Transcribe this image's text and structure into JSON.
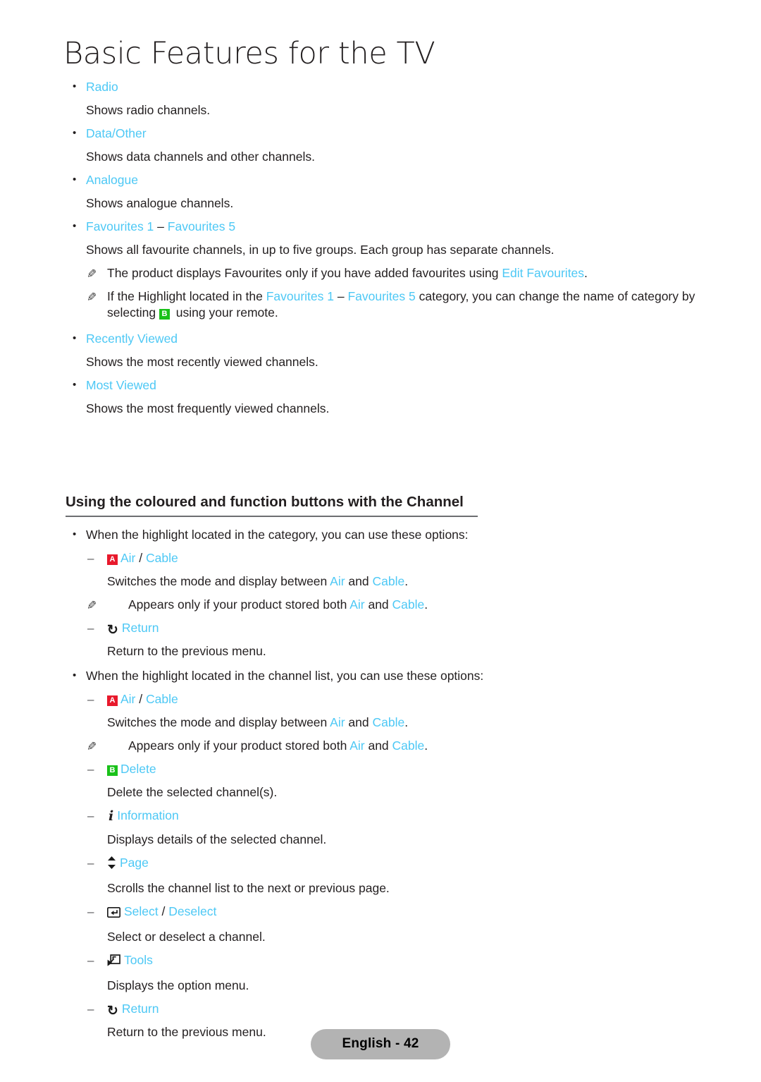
{
  "page_title": "Basic Features for the TV",
  "colors": {
    "link_cyan": "#4dc8f5",
    "text_black": "#231f20",
    "badge_a_red": "#e8192c",
    "badge_b_green": "#19c119",
    "heading_rule": "#6d6e71",
    "footer_pill_bg": "#b3b3b3"
  },
  "items": {
    "radio": {
      "term": "Radio",
      "desc": "Shows radio channels."
    },
    "data_other": {
      "term": "Data/Other",
      "desc": "Shows data channels and other channels."
    },
    "analogue": {
      "term": "Analogue",
      "desc": "Shows analogue channels."
    },
    "favourites": {
      "term_a": "Favourites 1",
      "term_dash": " – ",
      "term_b": "Favourites 5",
      "desc": "Shows all favourite channels, in up to five groups. Each group has separate channels.",
      "note1_pre": "The product displays Favourites only if you have added favourites using ",
      "note1_link": "Edit Favourites",
      "note1_post": ".",
      "note2_pre": "If the Highlight located in the ",
      "note2_link_a": "Favourites 1",
      "note2_dash": " – ",
      "note2_link_b": "Favourites 5",
      "note2_mid": " category, you can change the name of category by selecting ",
      "note2_badge": "B",
      "note2_post": " using your remote."
    },
    "recently_viewed": {
      "term": "Recently Viewed",
      "desc": "Shows the most recently viewed channels."
    },
    "most_viewed": {
      "term": "Most Viewed",
      "desc": "Shows the most frequently viewed channels."
    }
  },
  "section": {
    "heading": "Using the coloured and function buttons with the Channel",
    "category_intro": "When the highlight located in the category, you can use these options:",
    "channellist_intro": "When the highlight located in the channel list, you can use these options:",
    "air_cable": {
      "badge": "A",
      "label_air": "Air",
      "separator": " / ",
      "label_cable": "Cable",
      "desc_pre": "Switches the mode and display between ",
      "desc_air": "Air",
      "desc_mid": " and ",
      "desc_cable": "Cable",
      "desc_post": ".",
      "note_pre": "Appears only if your product stored both ",
      "note_air": "Air",
      "note_mid": " and ",
      "note_cable": "Cable",
      "note_post": "."
    },
    "return": {
      "icon": "return-arrow-icon",
      "label": "Return",
      "desc": "Return to the previous menu."
    },
    "delete": {
      "badge": "B",
      "label": "Delete",
      "desc": "Delete the selected channel(s)."
    },
    "information": {
      "icon": "information-i-icon",
      "label": "Information",
      "desc": "Displays details of the selected channel."
    },
    "page": {
      "icon": "up-down-arrow-icon",
      "label": "Page",
      "desc": "Scrolls the channel list to the next or previous page."
    },
    "select": {
      "icon": "enter-key-icon",
      "label_select": "Select",
      "separator": " / ",
      "label_deselect": "Deselect",
      "desc": "Select or deselect a channel."
    },
    "tools": {
      "icon": "tools-icon",
      "label": "Tools",
      "desc": "Displays the option menu."
    }
  },
  "footer": {
    "label": "English - 42"
  }
}
